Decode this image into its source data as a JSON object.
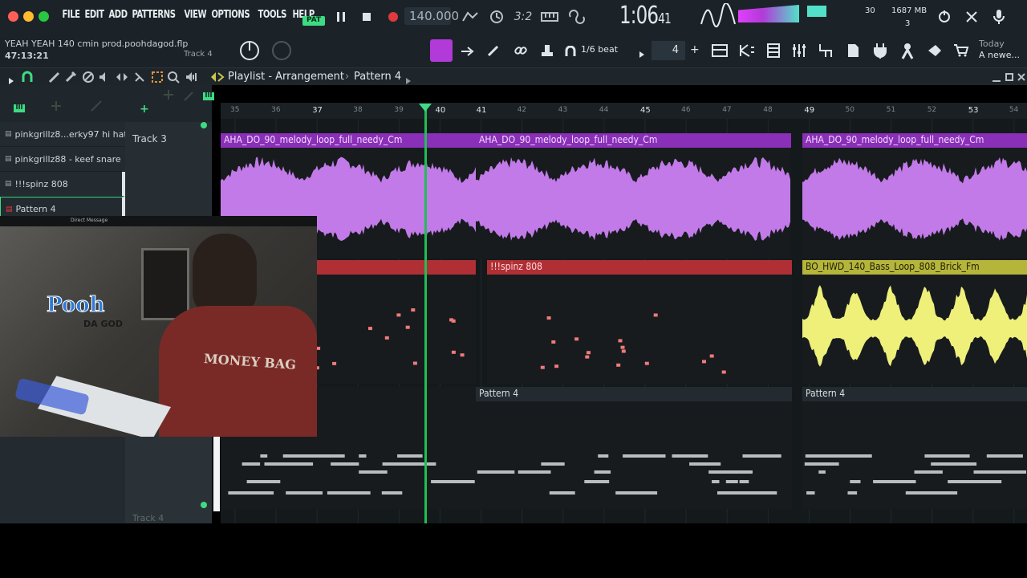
{
  "menu": [
    "FILE",
    "EDIT",
    "ADD",
    "PATTERNS",
    "VIEW",
    "OPTIONS",
    "TOOLS",
    "HELP"
  ],
  "transport": {
    "mode_label": "PAT",
    "tempo": "140.000",
    "time": "1:06",
    "time_sub": "41",
    "cpu_label": "30",
    "memory": "1687 MB",
    "voices": "3"
  },
  "project": {
    "title": "YEAH YEAH 140 cmin prod.poohdagod.flp",
    "elapsed": "47:13:21",
    "hint": "Track 4"
  },
  "snap": {
    "label": "1/6 beat",
    "step": "4"
  },
  "news": {
    "today": "Today",
    "headline": "A newe..."
  },
  "playlist": {
    "title": "Playlist - Arrangement",
    "separator": "›",
    "pattern": "Pattern 4"
  },
  "picker": [
    "pinkgrillz8...erky97 hi hat",
    "pinkgrillz88 - keef snare",
    "!!!spinz 808",
    "Pattern 4"
  ],
  "tracks": {
    "track3": "Track 3",
    "track4": "Track 4"
  },
  "ruler": [
    "35",
    "36",
    "37",
    "38",
    "39",
    "40",
    "41",
    "42",
    "43",
    "44",
    "45",
    "46",
    "47",
    "48",
    "49",
    "50",
    "51",
    "52",
    "53",
    "54"
  ],
  "clips": {
    "melody1": "AHA_DO_90_melody_loop_full_needy_Cm",
    "melody2": "AHA_DO_90_melody_loop_full_needy_Cm",
    "melody3": "AHA_DO_90_melody_loop_full_needy_Cm",
    "spinz": "!!!spinz 808",
    "bass": "BO_HWD_140_Bass_Loop_808_Brick_Fm",
    "pattern1": "Pattern 4",
    "pattern2": "Pattern 4"
  },
  "webcam": {
    "window_title": "Direct Message",
    "logo": "Pooh",
    "logo_sub": "DA GOD",
    "shirt": "MONEY BAG"
  },
  "colors": {
    "melody": "#a64dd6",
    "melody_wave": "#c27ae8",
    "spinz": "#c0353b",
    "bass": "#c9c94a",
    "bass_wave": "#eef07a",
    "accent": "#3ddc84"
  }
}
